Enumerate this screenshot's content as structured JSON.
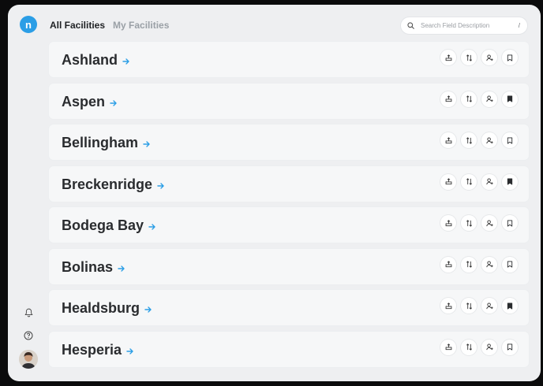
{
  "app": {
    "logo_letter": "n"
  },
  "tabs": [
    {
      "label": "All Facilities",
      "active": true
    },
    {
      "label": "My Facilities",
      "active": false
    }
  ],
  "search": {
    "placeholder": "Search Field Description",
    "value": "",
    "shortcut": "/"
  },
  "colors": {
    "accent": "#2b9ee6",
    "text": "#2a2c2f",
    "muted": "#9aa0a6"
  },
  "icons": {
    "arrow": "arrow-right-icon",
    "actions": [
      "upload-tray-icon",
      "sort-icon",
      "assign-user-icon",
      "bookmark-icon"
    ]
  },
  "facilities": [
    {
      "name": "Ashland",
      "bookmarked": false
    },
    {
      "name": "Aspen",
      "bookmarked": true
    },
    {
      "name": "Bellingham",
      "bookmarked": false
    },
    {
      "name": "Breckenridge",
      "bookmarked": true
    },
    {
      "name": "Bodega Bay",
      "bookmarked": false
    },
    {
      "name": "Bolinas",
      "bookmarked": false
    },
    {
      "name": "Healdsburg",
      "bookmarked": true
    },
    {
      "name": "Hesperia",
      "bookmarked": false
    }
  ]
}
